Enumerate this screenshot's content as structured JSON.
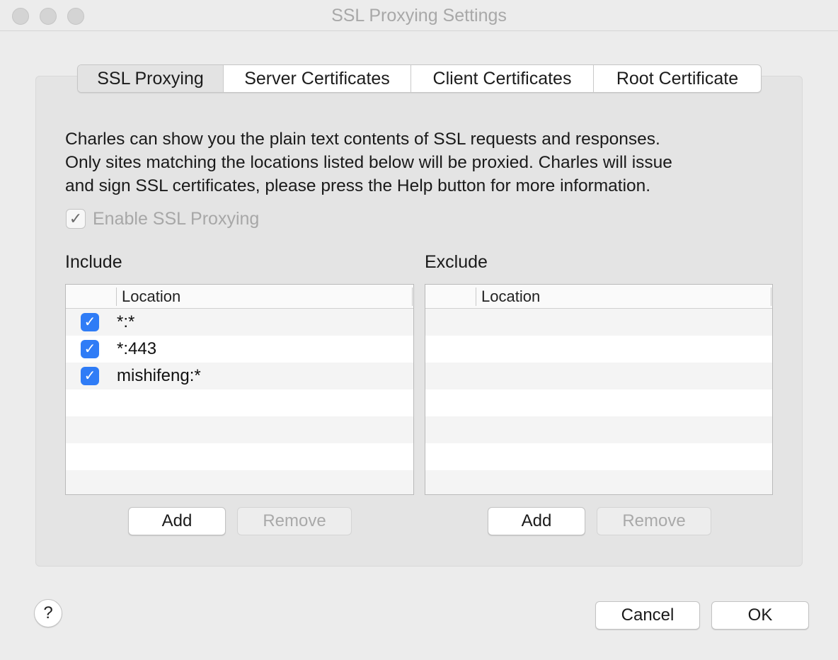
{
  "window": {
    "title": "SSL Proxying Settings"
  },
  "tabs": [
    {
      "label": "SSL Proxying",
      "selected": true
    },
    {
      "label": "Server Certificates",
      "selected": false
    },
    {
      "label": "Client Certificates",
      "selected": false
    },
    {
      "label": "Root Certificate",
      "selected": false
    }
  ],
  "description": {
    "line1": "Charles can show you the plain text contents of SSL requests and responses.",
    "line2": "Only sites matching the locations listed below will be proxied. Charles will issue",
    "line3": "and sign SSL certificates, please press the Help button for more information."
  },
  "enable_ssl": {
    "label": "Enable SSL Proxying",
    "checked": true
  },
  "include": {
    "label": "Include",
    "column_header": "Location",
    "rows": [
      {
        "checked": true,
        "location": "*:*"
      },
      {
        "checked": true,
        "location": "*:443"
      },
      {
        "checked": true,
        "location": "mishifeng:*"
      }
    ],
    "add_label": "Add",
    "remove_label": "Remove"
  },
  "exclude": {
    "label": "Exclude",
    "column_header": "Location",
    "rows": [],
    "add_label": "Add",
    "remove_label": "Remove"
  },
  "footer": {
    "help_label": "?",
    "cancel_label": "Cancel",
    "ok_label": "OK"
  },
  "icons": {
    "check": "checkmark-icon"
  },
  "colors": {
    "checkbox_accent": "#2f7cf6",
    "background": "#ececec"
  }
}
